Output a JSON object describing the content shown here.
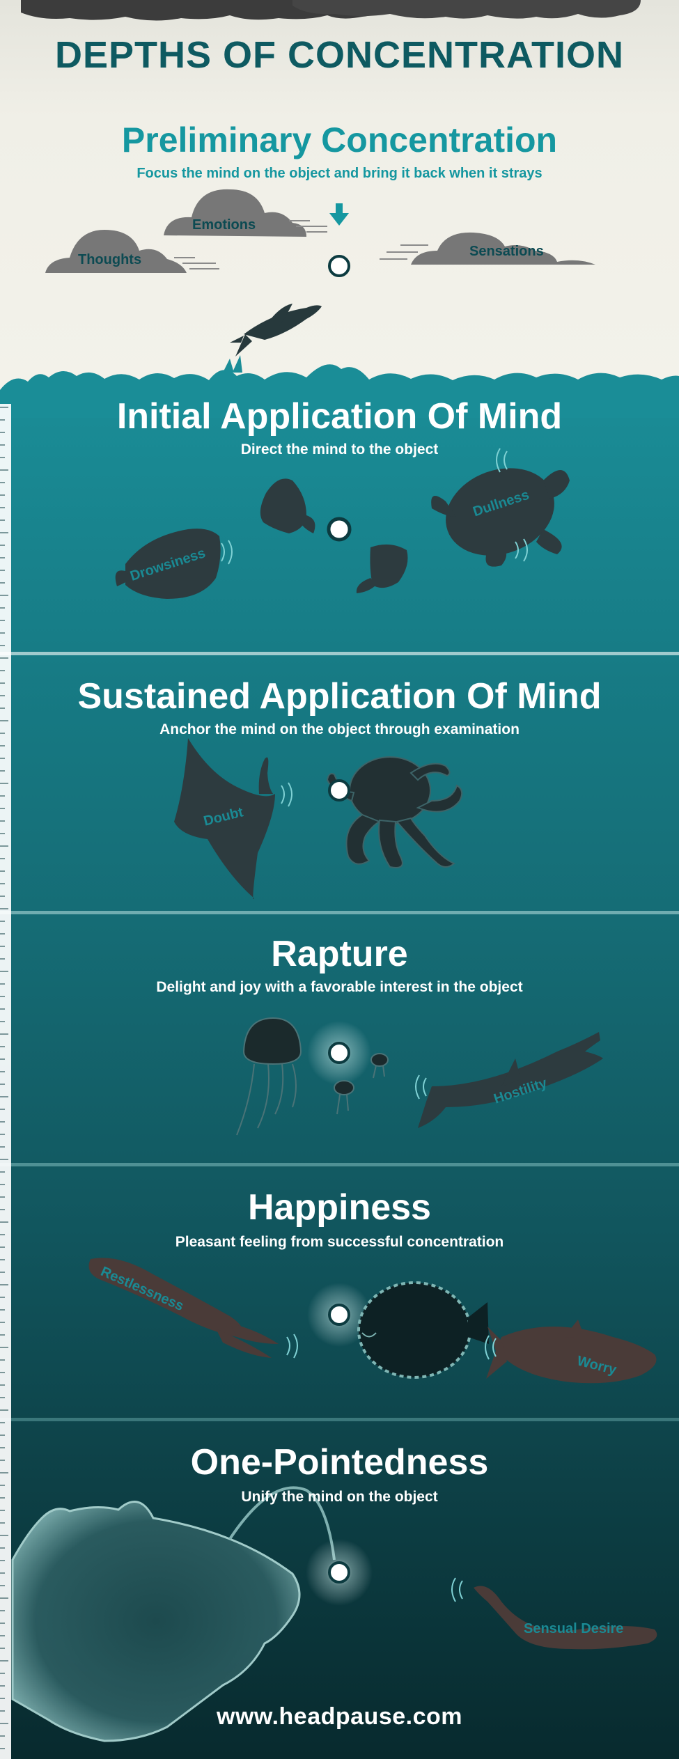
{
  "header": {
    "title": "DEPTHS OF CONCENTRATION"
  },
  "sections": [
    {
      "title": "Preliminary Concentration",
      "subtitle": "Focus the mind on the object and bring it back when it strays",
      "labels": [
        "Emotions",
        "Thoughts",
        "Sensations"
      ]
    },
    {
      "title": "Initial Application Of Mind",
      "subtitle": "Direct the mind to the object",
      "labels": [
        "Drowsiness",
        "Dullness"
      ]
    },
    {
      "title": "Sustained Application Of Mind",
      "subtitle": "Anchor the mind on the object through examination",
      "labels": [
        "Doubt"
      ]
    },
    {
      "title": "Rapture",
      "subtitle": "Delight and joy with a favorable interest in the object",
      "labels": [
        "Hostility"
      ]
    },
    {
      "title": "Happiness",
      "subtitle": "Pleasant feeling from successful concentration",
      "labels": [
        "Restlessness",
        "Worry"
      ]
    },
    {
      "title": "One-Pointedness",
      "subtitle": "Unify the mind on the object",
      "labels": [
        "Sensual Desire"
      ]
    }
  ],
  "footer": {
    "url": "www.headpause.com"
  },
  "colors": {
    "sky": "#efeee6",
    "cloud": "#6e6e6e",
    "accent": "#1597a0",
    "title_dark": "#0e5a61",
    "silhouette": "#2d3b3f",
    "water_top": "#157f8a",
    "water_bottom": "#0a2f33"
  },
  "icons": [
    "down-arrow-icon",
    "object-circle-icon",
    "wave-icon"
  ]
}
